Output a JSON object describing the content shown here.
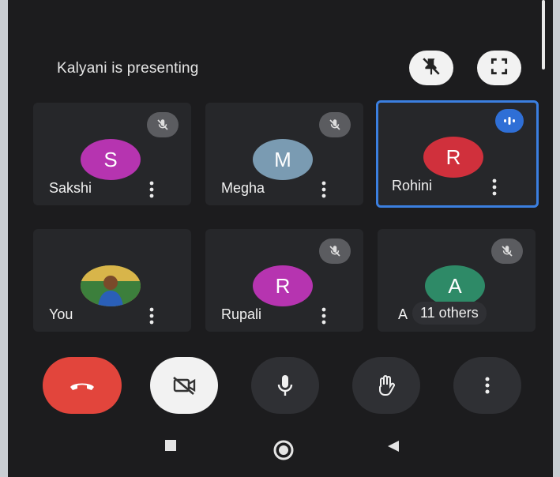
{
  "presenting_text": "Kalyani is presenting",
  "top_actions": [
    {
      "name": "unpin-icon"
    },
    {
      "name": "fullscreen-icon"
    }
  ],
  "participants": [
    {
      "name": "Sakshi",
      "initial": "S",
      "avatar_color": "#b634b0",
      "muted": true
    },
    {
      "name": "Megha",
      "initial": "M",
      "avatar_color": "#7a9bb2",
      "muted": true
    },
    {
      "name": "Rohini",
      "initial": "R",
      "avatar_color": "#d0303c",
      "muted": false,
      "speaking": true
    },
    {
      "name": "You",
      "initial": "",
      "avatar_color": "#e7a93a",
      "muted": false,
      "photo": true
    },
    {
      "name": "Rupali",
      "initial": "R",
      "avatar_color": "#b634b0",
      "muted": true
    },
    {
      "name": "A",
      "initial": "A",
      "avatar_color": "#2e8a67",
      "muted": true
    }
  ],
  "others_label": "11 others",
  "controls": [
    {
      "name": "end-call-button",
      "icon": "phone-hangup-icon",
      "color": "#e2453c"
    },
    {
      "name": "camera-off-button",
      "icon": "video-off-icon",
      "color": "#f2f2f2"
    },
    {
      "name": "microphone-button",
      "icon": "mic-icon",
      "color": "#2f3034"
    },
    {
      "name": "raise-hand-button",
      "icon": "hand-icon",
      "color": "#2f3034"
    },
    {
      "name": "more-options-button",
      "icon": "more-vert-icon",
      "color": "#2f3034"
    }
  ],
  "android_nav": [
    "recent-apps-icon",
    "home-icon",
    "back-icon"
  ],
  "colors": {
    "background": "#1c1c1e",
    "tile": "#26272a",
    "active_border": "#3b7fe0"
  }
}
